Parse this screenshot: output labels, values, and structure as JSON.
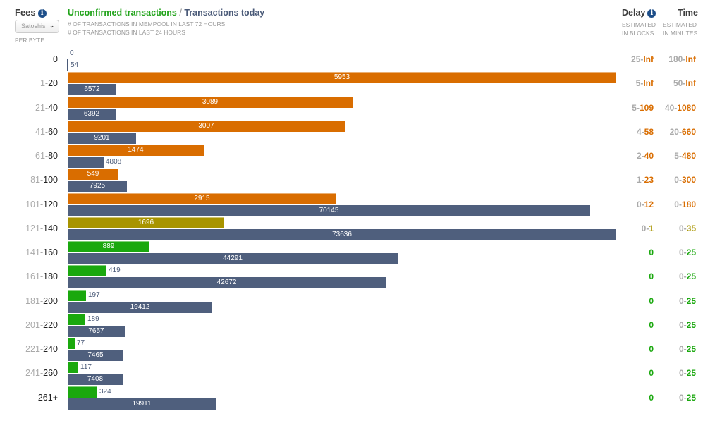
{
  "header": {
    "fees_label": "Fees",
    "info_icon": "i",
    "unit_select": "Satoshis",
    "per_byte": "PER BYTE",
    "title_unconfirmed": "Unconfirmed transactions",
    "title_sep": " / ",
    "title_today": "Transactions today",
    "sub1": "# OF TRANSACTIONS IN MEMPOOL IN LAST 72 HOURS",
    "sub2": "# OF TRANSACTIONS IN LAST 24 HOURS",
    "delay_label": "Delay",
    "delay_sub1": "ESTIMATED",
    "delay_sub2": "IN BLOCKS",
    "time_label": "Time",
    "time_sub1": "ESTIMATED",
    "time_sub2": "IN MINUTES"
  },
  "colors": {
    "orange": "#d96d00",
    "olive": "#a89400",
    "green": "#1aa80e",
    "navy": "#4f5f7d"
  },
  "chart_data": {
    "type": "bar",
    "orientation": "horizontal",
    "title": "Unconfirmed transactions / Transactions today",
    "categories": [
      "0",
      "1-20",
      "21-40",
      "41-60",
      "61-80",
      "81-100",
      "101-120",
      "121-140",
      "141-160",
      "161-180",
      "181-200",
      "201-220",
      "221-240",
      "241-260",
      "261+"
    ],
    "series": [
      {
        "name": "Unconfirmed transactions",
        "values": [
          0,
          5953,
          3089,
          3007,
          1474,
          549,
          2915,
          1696,
          889,
          419,
          197,
          189,
          77,
          117,
          324
        ]
      },
      {
        "name": "Transactions today",
        "values": [
          54,
          6572,
          6392,
          9201,
          4808,
          7925,
          70145,
          73636,
          44291,
          42672,
          19412,
          7657,
          7465,
          7408,
          19911
        ]
      }
    ],
    "row_status": [
      "orange",
      "orange",
      "orange",
      "orange",
      "orange",
      "orange",
      "orange",
      "olive",
      "green",
      "green",
      "green",
      "green",
      "green",
      "green",
      "green"
    ],
    "delay_blocks": [
      [
        "25",
        "Inf"
      ],
      [
        "5",
        "Inf"
      ],
      [
        "5",
        "109"
      ],
      [
        "4",
        "58"
      ],
      [
        "2",
        "40"
      ],
      [
        "1",
        "23"
      ],
      [
        "0",
        "12"
      ],
      [
        "0",
        "1"
      ],
      [
        "",
        "0"
      ],
      [
        "",
        "0"
      ],
      [
        "",
        "0"
      ],
      [
        "",
        "0"
      ],
      [
        "",
        "0"
      ],
      [
        "",
        "0"
      ],
      [
        "",
        "0"
      ]
    ],
    "time_minutes": [
      [
        "180",
        "Inf"
      ],
      [
        "50",
        "Inf"
      ],
      [
        "40",
        "1080"
      ],
      [
        "20",
        "660"
      ],
      [
        "5",
        "480"
      ],
      [
        "0",
        "300"
      ],
      [
        "0",
        "180"
      ],
      [
        "0",
        "35"
      ],
      [
        "0",
        "25"
      ],
      [
        "0",
        "25"
      ],
      [
        "0",
        "25"
      ],
      [
        "0",
        "25"
      ],
      [
        "0",
        "25"
      ],
      [
        "0",
        "25"
      ],
      [
        "0",
        "25"
      ]
    ]
  }
}
